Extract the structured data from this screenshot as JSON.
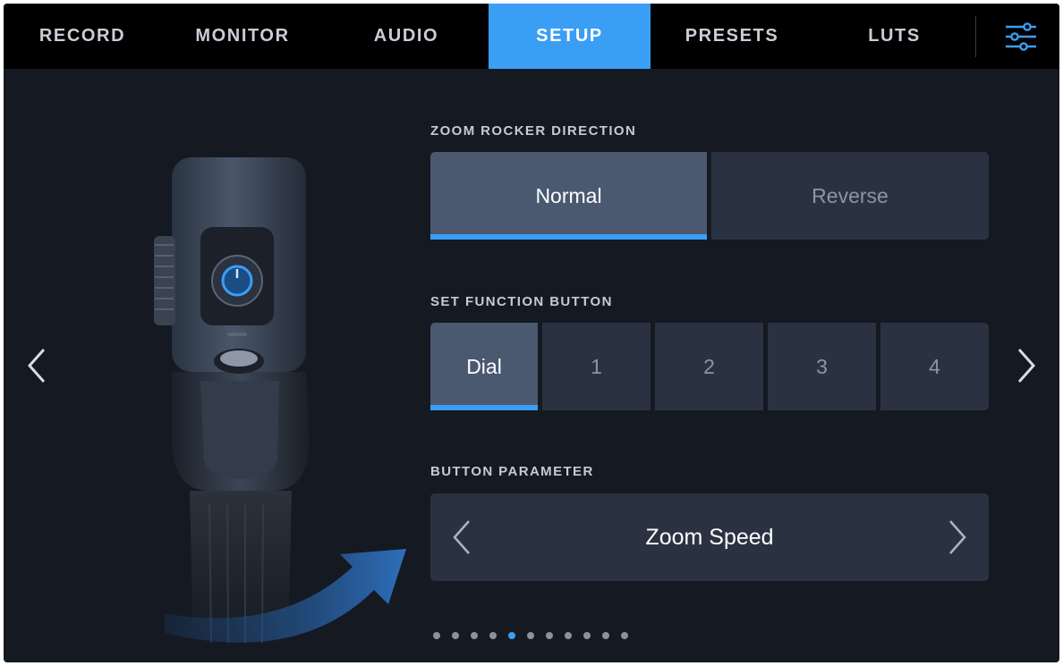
{
  "tabs": [
    {
      "label": "RECORD",
      "active": false
    },
    {
      "label": "MONITOR",
      "active": false
    },
    {
      "label": "AUDIO",
      "active": false
    },
    {
      "label": "SETUP",
      "active": true
    },
    {
      "label": "PRESETS",
      "active": false
    },
    {
      "label": "LUTS",
      "active": false
    }
  ],
  "settings_icon": "sliders-icon",
  "colors": {
    "accent": "#3b9ef5",
    "background": "#141922",
    "tab_bar": "#000000",
    "button": "#2a3242",
    "button_selected": "#4a5870"
  },
  "zoom_rocker": {
    "label": "ZOOM ROCKER DIRECTION",
    "options": [
      "Normal",
      "Reverse"
    ],
    "selected": "Normal"
  },
  "function_button": {
    "label": "SET FUNCTION BUTTON",
    "options": [
      "Dial",
      "1",
      "2",
      "3",
      "4"
    ],
    "selected": "Dial"
  },
  "button_parameter": {
    "label": "BUTTON PARAMETER",
    "value": "Zoom Speed"
  },
  "pagination": {
    "total": 11,
    "current": 5
  }
}
